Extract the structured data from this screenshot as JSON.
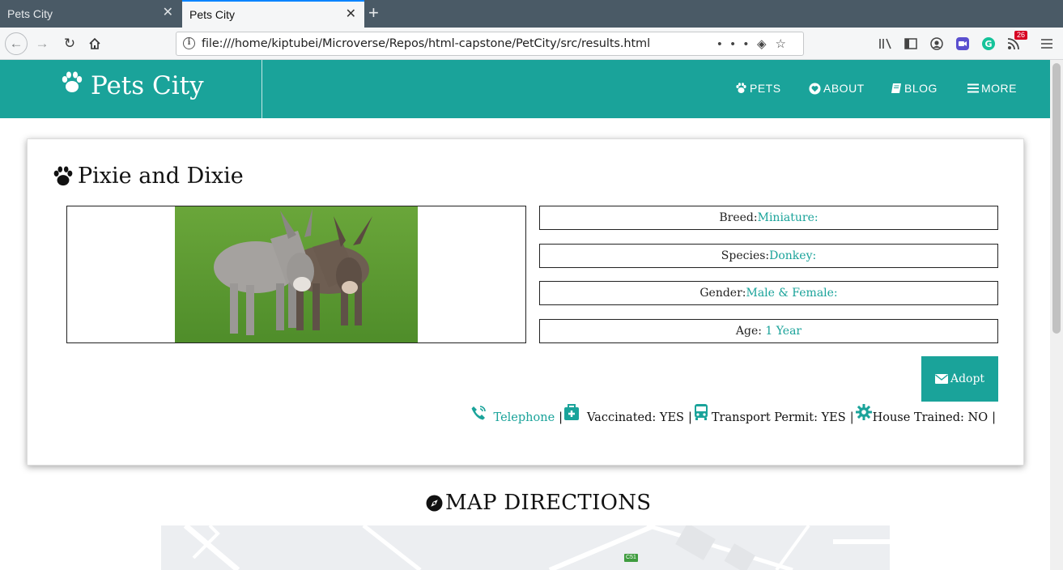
{
  "browser": {
    "tabs": [
      {
        "title": "Pets City",
        "active": false
      },
      {
        "title": "Pets City",
        "active": true
      }
    ],
    "url": "file:///home/kiptubei/Microverse/Repos/html-capstone/PetCity/src/results.html",
    "notification_count": "26"
  },
  "site": {
    "brand": "Pets City",
    "menu": [
      {
        "label": "PETS",
        "icon": "paw-icon"
      },
      {
        "label": "ABOUT",
        "icon": "heart-icon"
      },
      {
        "label": "BLOG",
        "icon": "book-icon"
      },
      {
        "label": "MORE",
        "icon": "menu-icon"
      }
    ],
    "accent_color": "#1aa39a"
  },
  "pet": {
    "name": "Pixie and Dixie",
    "details": [
      {
        "label": "Breed:",
        "value": "Miniature:"
      },
      {
        "label": "Species:",
        "value": "Donkey:"
      },
      {
        "label": "Gender:",
        "value": "Male & Female:"
      },
      {
        "label": "Age: ",
        "value": "1 Year"
      }
    ],
    "adopt_label": "Adopt",
    "features": {
      "telephone": "Telephone",
      "vaccinated": "Vaccinated: YES",
      "transport": "Transport Permit: YES",
      "house_trained": "House Trained: NO",
      "separator": "|"
    }
  },
  "map": {
    "heading": "MAP DIRECTIONS",
    "road_label": "C51"
  }
}
